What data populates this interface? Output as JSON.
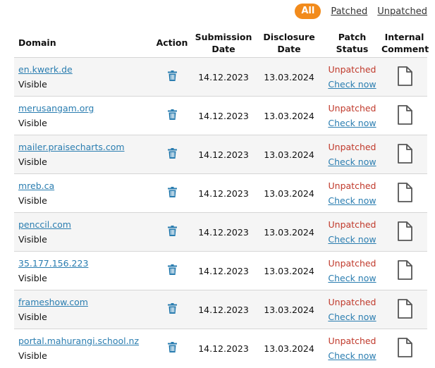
{
  "filters": {
    "all": "All",
    "patched": "Patched",
    "unpatched": "Unpatched"
  },
  "headers": {
    "domain": "Domain",
    "action": "Action",
    "submission_1": "Submission",
    "submission_2": "Date",
    "disclosure_1": "Disclosure",
    "disclosure_2": "Date",
    "patch_1": "Patch",
    "patch_2": "Status",
    "comment_1": "Internal",
    "comment_2": "Comment"
  },
  "colors": {
    "accent_orange": "#f28b1c",
    "link_blue": "#2a7db0",
    "unpatched_red": "#c0392b"
  },
  "icons": {
    "action": "trash-icon",
    "comment": "document-icon"
  },
  "rows": [
    {
      "domain": "en.kwerk.de",
      "visibility": "Visible",
      "submission": "14.12.2023",
      "disclosure": "13.03.2024",
      "status": "Unpatched",
      "check": "Check now"
    },
    {
      "domain": "merusangam.org",
      "visibility": "Visible",
      "submission": "14.12.2023",
      "disclosure": "13.03.2024",
      "status": "Unpatched",
      "check": "Check now"
    },
    {
      "domain": "mailer.praisecharts.com",
      "visibility": "Visible",
      "submission": "14.12.2023",
      "disclosure": "13.03.2024",
      "status": "Unpatched",
      "check": "Check now"
    },
    {
      "domain": "mreb.ca",
      "visibility": "Visible",
      "submission": "14.12.2023",
      "disclosure": "13.03.2024",
      "status": "Unpatched",
      "check": "Check now"
    },
    {
      "domain": "penccil.com",
      "visibility": "Visible",
      "submission": "14.12.2023",
      "disclosure": "13.03.2024",
      "status": "Unpatched",
      "check": "Check now"
    },
    {
      "domain": "35.177.156.223",
      "visibility": "Visible",
      "submission": "14.12.2023",
      "disclosure": "13.03.2024",
      "status": "Unpatched",
      "check": "Check now"
    },
    {
      "domain": "frameshow.com",
      "visibility": "Visible",
      "submission": "14.12.2023",
      "disclosure": "13.03.2024",
      "status": "Unpatched",
      "check": "Check now"
    },
    {
      "domain": "portal.mahurangi.school.nz",
      "visibility": "Visible",
      "submission": "14.12.2023",
      "disclosure": "13.03.2024",
      "status": "Unpatched",
      "check": "Check now"
    }
  ]
}
